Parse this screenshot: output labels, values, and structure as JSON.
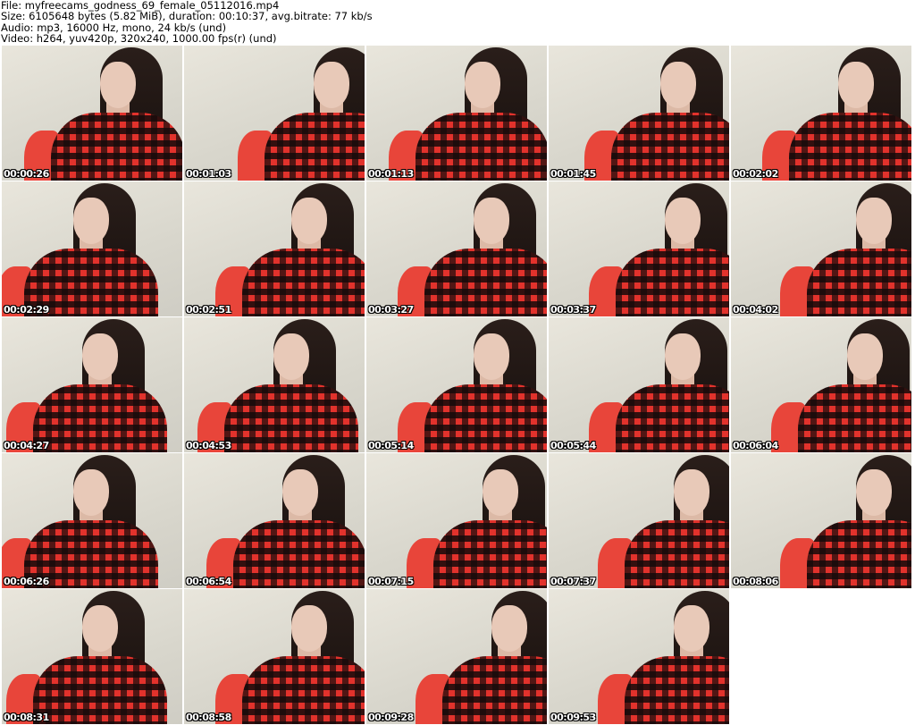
{
  "info": {
    "file": "File: myfreecams_godness_69_female_05112016.mp4",
    "size": "Size: 6105648 bytes (5.82 MiB), duration: 00:10:37, avg.bitrate: 77 kb/s",
    "audio": "Audio: mp3, 16000 Hz, mono, 24 kb/s (und)",
    "video": "Video: h264, yuv420p, 320x240, 1000.00 fps(r) (und)"
  },
  "thumbnails": [
    {
      "timestamp": "00:00:26"
    },
    {
      "timestamp": "00:01:03"
    },
    {
      "timestamp": "00:01:13"
    },
    {
      "timestamp": "00:01:45"
    },
    {
      "timestamp": "00:02:02"
    },
    {
      "timestamp": "00:02:29"
    },
    {
      "timestamp": "00:02:51"
    },
    {
      "timestamp": "00:03:27"
    },
    {
      "timestamp": "00:03:37"
    },
    {
      "timestamp": "00:04:02"
    },
    {
      "timestamp": "00:04:27"
    },
    {
      "timestamp": "00:04:53"
    },
    {
      "timestamp": "00:05:14"
    },
    {
      "timestamp": "00:05:44"
    },
    {
      "timestamp": "00:06:04"
    },
    {
      "timestamp": "00:06:26"
    },
    {
      "timestamp": "00:06:54"
    },
    {
      "timestamp": "00:07:15"
    },
    {
      "timestamp": "00:07:37"
    },
    {
      "timestamp": "00:08:06"
    },
    {
      "timestamp": "00:08:31"
    },
    {
      "timestamp": "00:08:58"
    },
    {
      "timestamp": "00:09:28"
    },
    {
      "timestamp": "00:09:53"
    }
  ]
}
